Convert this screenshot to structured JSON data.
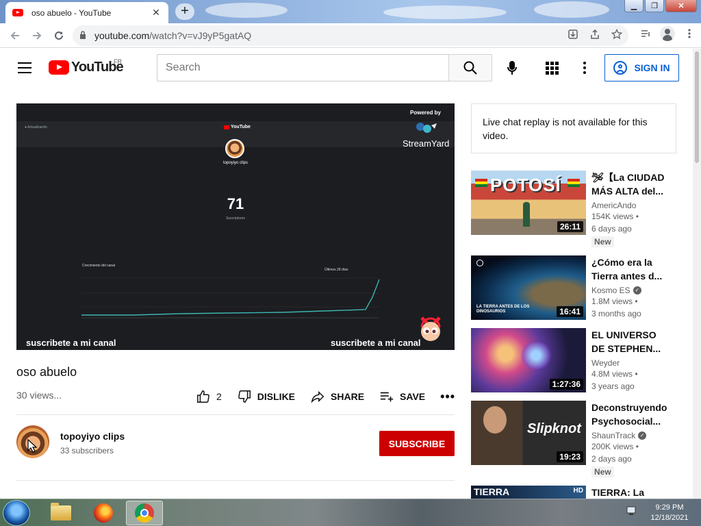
{
  "browser": {
    "tab_title": "oso abuelo - YouTube",
    "tab_close": "✕",
    "new_tab": "+",
    "url_host": "youtube.com",
    "url_path": "/watch?v=vJ9yP5gatAQ",
    "window_controls": {
      "minimize": "▁",
      "restore": "❐",
      "close": "✕"
    }
  },
  "header": {
    "logo_text": "YouTube",
    "country_code": "FR",
    "search_placeholder": "Search",
    "signin_label": "SIGN IN"
  },
  "player": {
    "powered_by": "Powered by",
    "streamyard": "StreamYard",
    "yt_mini": "YouTube",
    "channel_name": "topoyiyo clips",
    "subscriber_count": "71",
    "subscriber_label": "Suscriptores",
    "chart_title": "Crecimiento del canal",
    "chart_period": "Últimos 28 días",
    "caption_left": "suscribete a mi canal",
    "caption_right": "suscribete a mi canal"
  },
  "video": {
    "title": "oso abuelo",
    "views": "30 views...",
    "like_count": "2",
    "dislike_label": "DISLIKE",
    "share_label": "SHARE",
    "save_label": "SAVE",
    "more_label": "•••"
  },
  "owner": {
    "name": "topoyiyo clips",
    "subscribers": "33 subscribers",
    "subscribe_label": "SUBSCRIBE"
  },
  "sidebar": {
    "chat_notice": "Live chat replay is not available for this video.",
    "recommendations": [
      {
        "title": "🛩【La CIUDAD MÁS ALTA del...",
        "channel": "AmericAndo",
        "verified": false,
        "views": "154K views •",
        "age": "6 days ago",
        "duration": "26:11",
        "badge": "New",
        "thumb_text": "POTOSÍ"
      },
      {
        "title": "¿Cómo era la Tierra antes d...",
        "channel": "Kosmo ES",
        "verified": true,
        "views": "1.8M views •",
        "age": "3 months ago",
        "duration": "16:41",
        "badge": "",
        "thumb_text": "LA TIERRA ANTES DE LOS DINOSAURIOS"
      },
      {
        "title": "EL UNIVERSO DE STEPHEN...",
        "channel": "Weyder",
        "verified": false,
        "views": "4.8M views •",
        "age": "3 years ago",
        "duration": "1:27:36",
        "badge": "",
        "thumb_text": ""
      },
      {
        "title": "Deconstruyendo Psychosocial...",
        "channel": "ShaunTrack",
        "verified": true,
        "views": "200K views •",
        "age": "2 days ago",
        "duration": "19:23",
        "badge": "New",
        "thumb_text": "Slipknot"
      },
      {
        "title": "TIERRA: La",
        "channel": "",
        "verified": false,
        "views": "",
        "age": "",
        "duration": "",
        "badge": "",
        "thumb_text": "TIERRA"
      }
    ]
  },
  "taskbar": {
    "time": "9:29 PM",
    "date": "12/18/2021"
  },
  "colors": {
    "yt_red": "#ff0000",
    "subscribe_red": "#cc0000",
    "signin_blue": "#065fd4",
    "player_bg": "#1c1d21"
  }
}
